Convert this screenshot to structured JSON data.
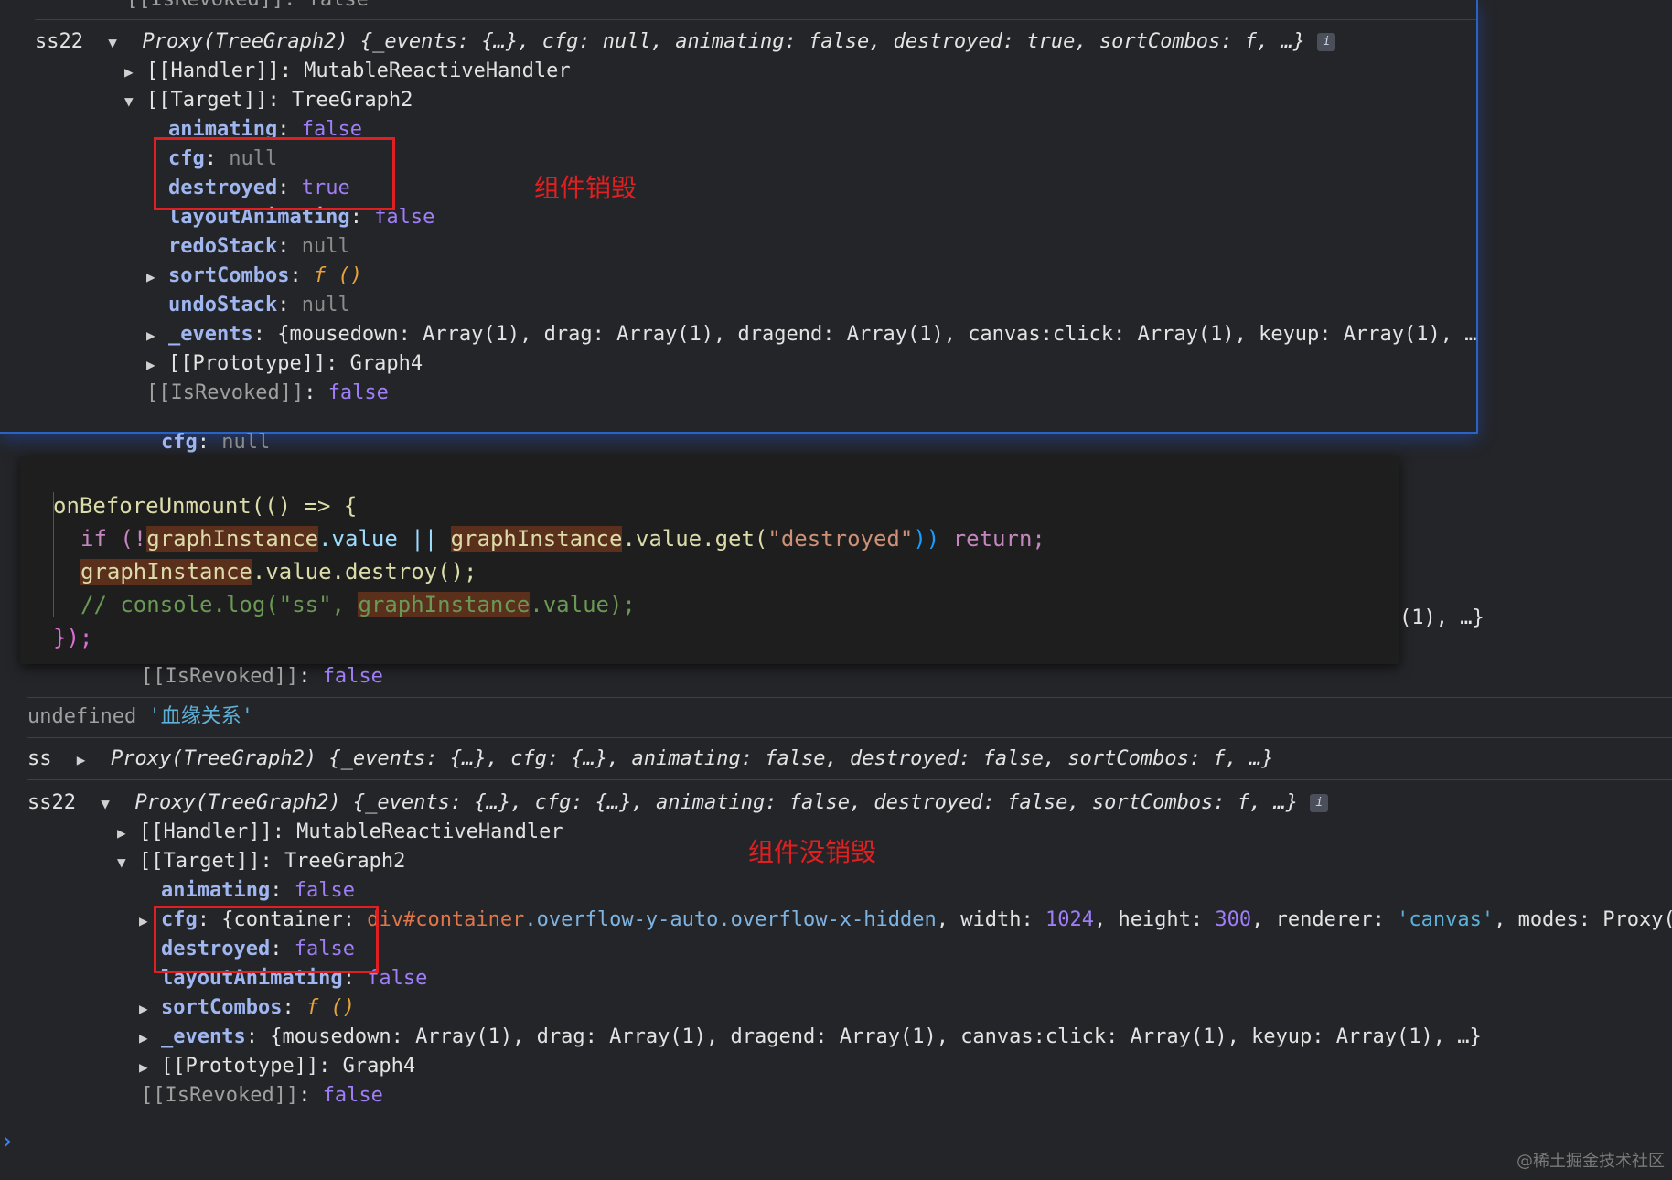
{
  "top_panel": {
    "cut_line": "[[IsRevoked]]: false",
    "ss22_label": "ss22",
    "proxy_summary": "Proxy(TreeGraph2) {_events: {…}, cfg: null, animating: false, destroyed: true, sortCombos: f, …}",
    "handler": "[[Handler]]: MutableReactiveHandler",
    "target": "[[Target]]: TreeGraph2",
    "animating_key": "animating",
    "animating_val": "false",
    "cfg_key": "cfg",
    "cfg_val": "null",
    "destroyed_key": "destroyed",
    "destroyed_val": "true",
    "layout_key": "layoutAnimating",
    "layout_val": "false",
    "redo_key": "redoStack",
    "redo_val": "null",
    "sort_key": "sortCombos",
    "sort_val": "f ()",
    "undo_key": "undoStack",
    "undo_val": "null",
    "events_key": "_events",
    "events_val": "{mousedown: Array(1), drag: Array(1), dragend: Array(1), canvas:click: Array(1), keyup: Array(1), …",
    "proto": "[[Prototype]]: Graph4",
    "revoked_key": "[[IsRevoked]]",
    "revoked_val": "false",
    "annotation": "组件销毁"
  },
  "peek_cfg": {
    "key": "cfg",
    "val": "null"
  },
  "code": {
    "line1": "onBeforeUnmount(() => {",
    "line2_a": "if (!",
    "line2_b": "graphInstance",
    "line2_c": ".value || ",
    "line2_d": "graphInstance",
    "line2_e": ".value.get(",
    "line2_f": "\"destroyed\"",
    "line2_g": ")) ",
    "line2_h": "return;",
    "line3_a": "graphInstance",
    "line3_b": ".value.destroy();",
    "line4_a": "// console.log(\"ss\", ",
    "line4_b": "graphInstance",
    "line4_c": ".value);",
    "line5": "});"
  },
  "peek_right": "(1), …}",
  "peek_revoked": {
    "key": "[[IsRevoked]]",
    "val": "false"
  },
  "undefined_line": {
    "undef": "undefined",
    "str": "'血缘关系'"
  },
  "ss_line": {
    "label": "ss",
    "summary": "Proxy(TreeGraph2) {_events: {…}, cfg: {…}, animating: false, destroyed: false, sortCombos: f, …}"
  },
  "bottom_panel": {
    "ss22_label": "ss22",
    "proxy_summary": "Proxy(TreeGraph2) {_events: {…}, cfg: {…}, animating: false, destroyed: false, sortCombos: f, …}",
    "handler": "[[Handler]]: MutableReactiveHandler",
    "target": "[[Target]]: TreeGraph2",
    "animating_key": "animating",
    "animating_val": "false",
    "cfg_key": "cfg",
    "cfg_container": "{container: ",
    "cfg_div": "div",
    "cfg_sel": "#container",
    "cfg_classes": ".overflow-y-auto.overflow-x-hidden",
    "cfg_width_key": ", width: ",
    "cfg_width": "1024",
    "cfg_height_key": ", height: ",
    "cfg_height": "300",
    "cfg_renderer_key": ", renderer: ",
    "cfg_renderer": "'canvas'",
    "cfg_modes": ", modes: Proxy(",
    "destroyed_key": "destroyed",
    "destroyed_val": "false",
    "layout_key": "layoutAnimating",
    "layout_val": "false",
    "sort_key": "sortCombos",
    "sort_val": "f ()",
    "events_key": "_events",
    "events_val": "{mousedown: Array(1), drag: Array(1), dragend: Array(1), canvas:click: Array(1), keyup: Array(1), …}",
    "proto": "[[Prototype]]: Graph4",
    "revoked_key": "[[IsRevoked]]",
    "revoked_val": "false",
    "annotation": "组件没销毁"
  },
  "prompt_glyph": "›",
  "watermark": "@稀土掘金技术社区"
}
